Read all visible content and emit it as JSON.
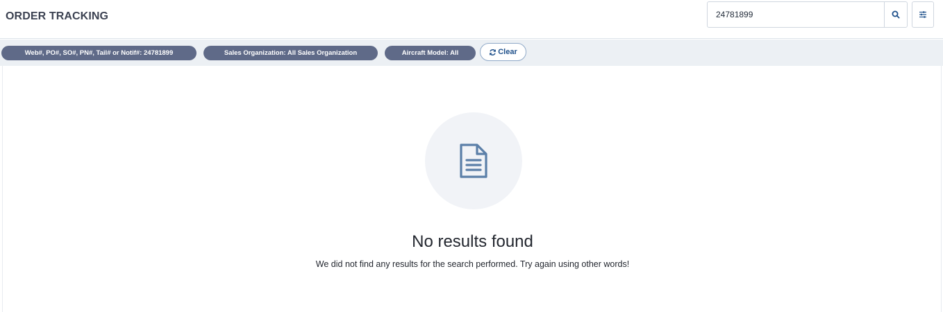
{
  "header": {
    "title": "ORDER TRACKING"
  },
  "search": {
    "value": "24781899",
    "icon": "search-icon"
  },
  "filter_button": {
    "icon": "sliders-icon"
  },
  "filters": {
    "chips": [
      {
        "label": "Web#, PO#, SO#, PN#, Tail# or Notif#: 24781899"
      },
      {
        "label": "Sales Organization: All Sales Organization"
      },
      {
        "label": "Aircraft Model: All"
      }
    ],
    "clear_label": "Clear",
    "clear_icon": "refresh-icon",
    "chip_color": "#5f6a88"
  },
  "empty_state": {
    "icon": "document-icon",
    "title": "No results found",
    "message": "We did not find any results for the search performed. Try again using other words!"
  },
  "colors": {
    "accent": "#1d4f8a",
    "icon": "#5b7fa8"
  }
}
